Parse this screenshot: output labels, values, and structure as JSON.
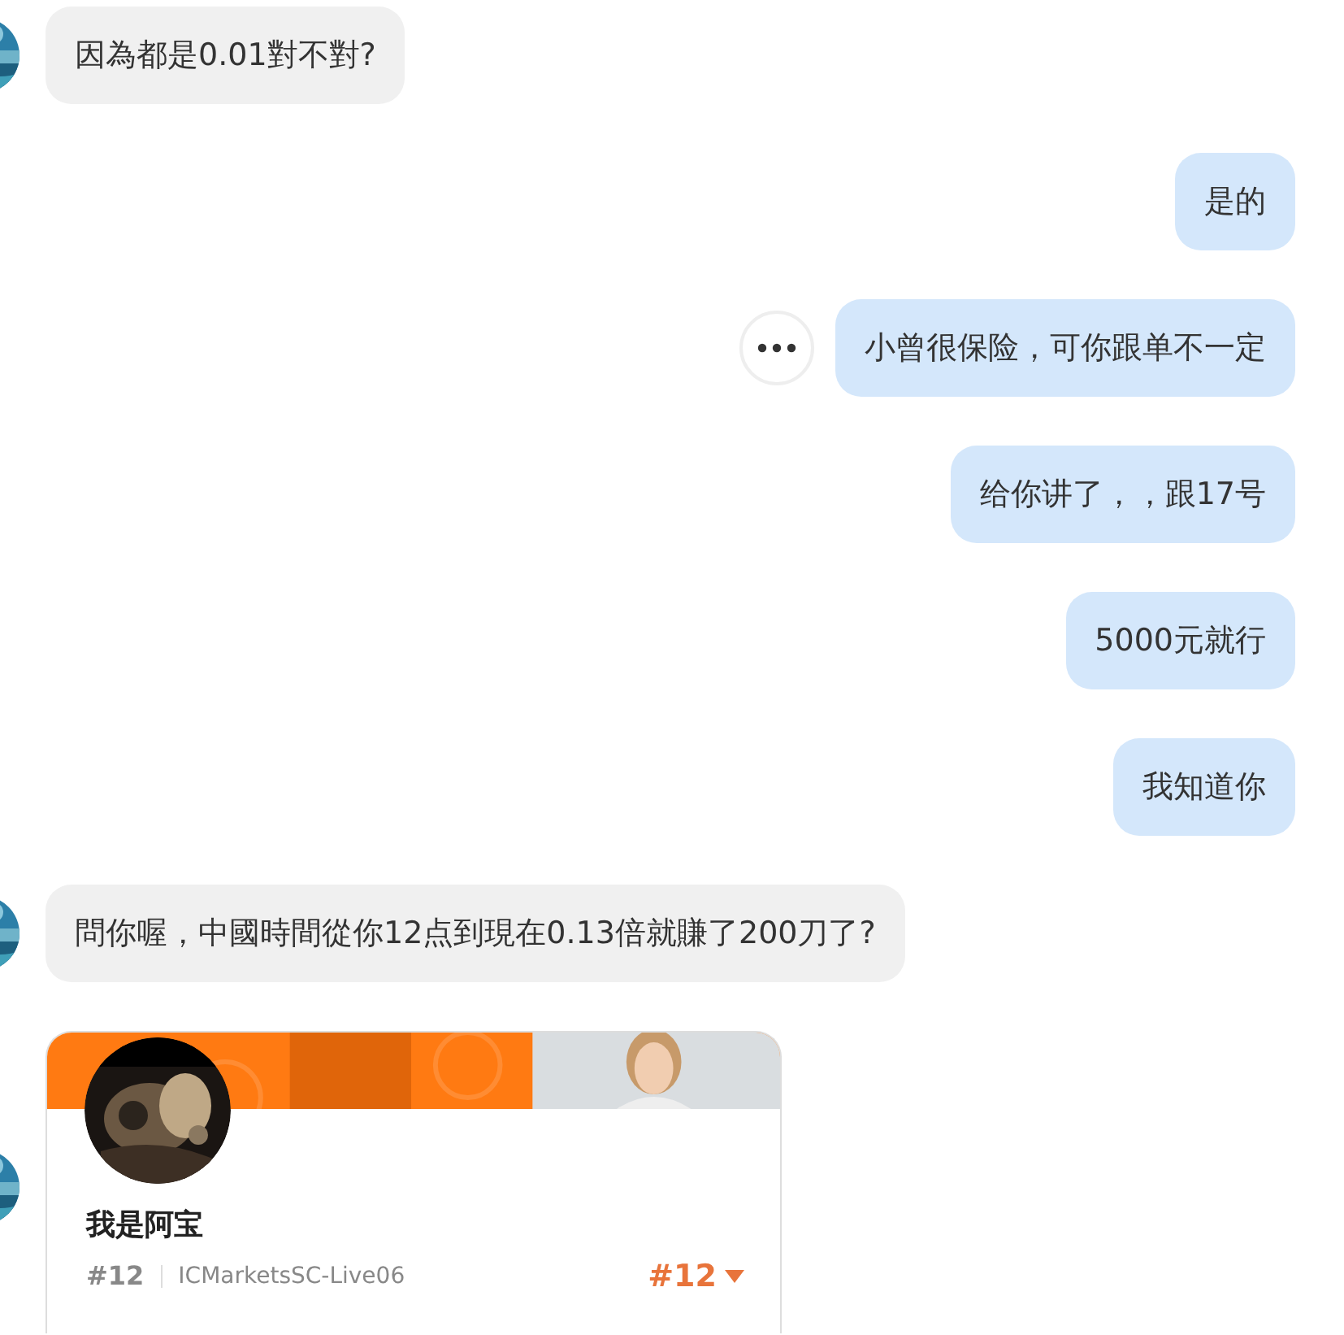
{
  "messages": [
    {
      "kind": "text",
      "outgoing": false,
      "avatar": true,
      "more_button": false,
      "text": "因為都是0.01對不對?"
    },
    {
      "kind": "text",
      "outgoing": true,
      "avatar": false,
      "more_button": false,
      "text": "是的"
    },
    {
      "kind": "text",
      "outgoing": true,
      "avatar": false,
      "more_button": true,
      "text": "小曾很保险，可你跟单不一定"
    },
    {
      "kind": "text",
      "outgoing": true,
      "avatar": false,
      "more_button": false,
      "text": "给你讲了，，跟17号"
    },
    {
      "kind": "text",
      "outgoing": true,
      "avatar": false,
      "more_button": false,
      "text": "5000元就行"
    },
    {
      "kind": "text",
      "outgoing": true,
      "avatar": false,
      "more_button": false,
      "text": "我知道你"
    },
    {
      "kind": "text",
      "outgoing": false,
      "avatar": true,
      "more_button": false,
      "text": "問你喔，中國時間從你12点到現在0.13倍就賺了200刀了?"
    },
    {
      "kind": "card",
      "outgoing": false,
      "avatar": true,
      "more_button": false,
      "name": "我是阿宝",
      "rank": "#12",
      "server": "ICMarketsSC-Live06",
      "badge": "#12"
    }
  ]
}
